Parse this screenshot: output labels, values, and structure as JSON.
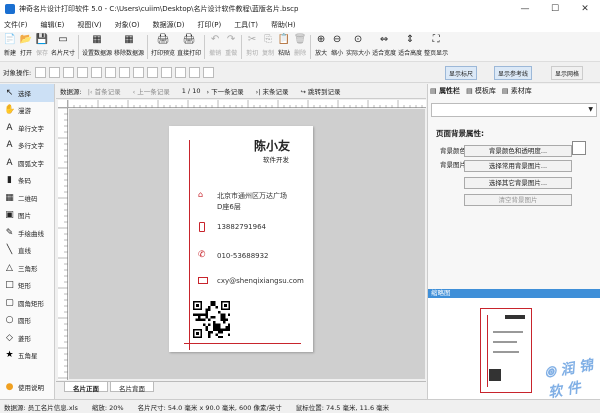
{
  "app": {
    "title": "神奇名片设计打印软件 5.0 - C:\\Users\\cuiim\\Desktop\\名片设计软件教程\\蓝版名片.bscp",
    "min": "—",
    "max": "☐",
    "close": "✕"
  },
  "menu": [
    "文件(F)",
    "编辑(E)",
    "视图(V)",
    "对象(O)",
    "数据源(D)",
    "打印(P)",
    "工具(T)",
    "帮助(H)"
  ],
  "toolbar": [
    {
      "label": "新建",
      "icon": "📄",
      "dis": false
    },
    {
      "label": "打开",
      "icon": "📂",
      "dis": false
    },
    {
      "label": "保存",
      "icon": "💾",
      "dis": true
    },
    {
      "label": "名片尺寸",
      "icon": "▭",
      "dis": false
    },
    {
      "label": "设置数据源",
      "icon": "▦",
      "dis": false
    },
    {
      "label": "移除数据源",
      "icon": "▦",
      "dis": false
    },
    {
      "label": "打印预览",
      "icon": "🖨",
      "dis": false
    },
    {
      "label": "直接打印",
      "icon": "🖨",
      "dis": false
    },
    {
      "label": "撤销",
      "icon": "↶",
      "dis": true
    },
    {
      "label": "重做",
      "icon": "↷",
      "dis": true
    },
    {
      "label": "剪切",
      "icon": "✂",
      "dis": true
    },
    {
      "label": "复制",
      "icon": "⎘",
      "dis": true
    },
    {
      "label": "粘贴",
      "icon": "📋",
      "dis": false
    },
    {
      "label": "删除",
      "icon": "🗑",
      "dis": true
    },
    {
      "label": "放大",
      "icon": "⊕",
      "dis": false
    },
    {
      "label": "缩小",
      "icon": "⊖",
      "dis": false
    },
    {
      "label": "实际大小",
      "icon": "⊙",
      "dis": false
    },
    {
      "label": "适合宽度",
      "icon": "⇔",
      "dis": false
    },
    {
      "label": "适合高度",
      "icon": "⇕",
      "dis": false
    },
    {
      "label": "整页显示",
      "icon": "⛶",
      "dis": false
    }
  ],
  "objbar": {
    "label": "对象操作:",
    "show_ruler": "显示标尺",
    "show_guides": "显示参考线",
    "show_grid": "显示网格"
  },
  "tools": [
    {
      "icon": "↖",
      "label": "选择"
    },
    {
      "icon": "✋",
      "label": "漫游"
    },
    {
      "icon": "A",
      "label": "单行文字"
    },
    {
      "icon": "A",
      "label": "多行文字"
    },
    {
      "icon": "A",
      "label": "圆弧文字"
    },
    {
      "icon": "▮",
      "label": "条码"
    },
    {
      "icon": "▦",
      "label": "二维码"
    },
    {
      "icon": "▣",
      "label": "图片"
    },
    {
      "icon": "✎",
      "label": "手绘曲线"
    },
    {
      "icon": "╲",
      "label": "直线"
    },
    {
      "icon": "△",
      "label": "三角形"
    },
    {
      "icon": "□",
      "label": "矩形"
    },
    {
      "icon": "▢",
      "label": "圆角矩形"
    },
    {
      "icon": "○",
      "label": "圆形"
    },
    {
      "icon": "◇",
      "label": "菱形"
    },
    {
      "icon": "★",
      "label": "五角星"
    }
  ],
  "help": "使用说明",
  "nav": {
    "label": "数据源:",
    "first": "首条记录",
    "prev": "上一条记录",
    "page": "1 / 10",
    "next": "下一条记录",
    "last": "末条记录",
    "jump": "跳转到记录"
  },
  "card": {
    "name": "陈小友",
    "title": "软件开发",
    "address1": "北京市通州区万达广场",
    "address2": "D座6层",
    "phone": "13882791964",
    "tel": "010-53688932",
    "email": "cxy@shenqixiangsu.com"
  },
  "tabs": [
    "名片正面",
    "名片背面"
  ],
  "rpanel": {
    "tabs": [
      "属性栏",
      "模板库",
      "素材库"
    ],
    "heading": "页面背景属性:",
    "bgcolor_label": "背景颜色:",
    "bgimage_label": "背景图片:",
    "btn_color": "背景颜色和透明度...",
    "btn_common": "选择常用背景图片...",
    "btn_other": "选择其它背景图片...",
    "btn_clear": "清空背景图片",
    "thumb": "缩略图"
  },
  "status": {
    "source": "数据源: 员工名片信息.xls",
    "zoom": "缩放: 20%",
    "size": "名片尺寸: 54.0 毫米 x 90.0 毫米, 600 像素/英寸",
    "pos": "鼠标位置: 74.5 毫米, 11.6 毫米"
  },
  "colors": {
    "accent": "#c8242c",
    "brand": "#1a6fd1"
  }
}
